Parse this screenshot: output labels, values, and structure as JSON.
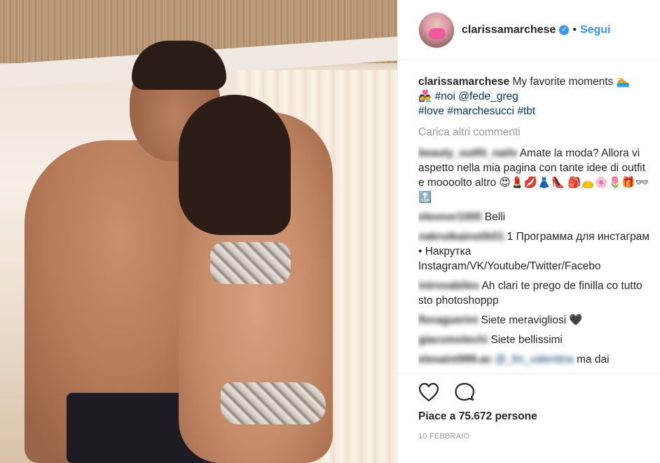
{
  "post": {
    "username": "clarissamarchese",
    "follow_label": "Segui",
    "separator": "•",
    "verified_glyph": "✓",
    "caption": {
      "username": "clarissamarchese",
      "text": "My favorite moments 🏊",
      "line2_emoji": "👩‍❤️‍👨",
      "hashtag_noi": "#noi",
      "mention": "@fede_greg",
      "hashtag_love": "#love",
      "hashtag_marchesucci": "#marchesucci",
      "hashtag_tbt": "#tbt"
    },
    "load_more": "Carica altri commenti",
    "comments": [
      {
        "user": "beauty_outfit_nails",
        "text": "Amate la moda? Allora vi aspetto nella mia pagina con tante idee di outfit e moooolto altro 😍💄💋👗👠 🎒👝🌸🌷🎁👓🔝"
      },
      {
        "user": "eleonor1000",
        "text": "Belli"
      },
      {
        "user": "nakrutkainstik01",
        "text": "1 Программа для инстаграм • Накрутка Instagram/VK/Youtube/Twitter/Facebo"
      },
      {
        "user": "introvabiles",
        "text": "Ah clari te prego de finilla co tutto sto photoshoppp"
      },
      {
        "user": "floraguerini",
        "text": "Siete meravigliosi 🖤"
      },
      {
        "user": "giacomolechi",
        "text": "Siete bellissimi"
      },
      {
        "user": "elesaint999.ac",
        "mention": "@_fm_valentina",
        "text": "ma dai"
      }
    ],
    "likes_text": "Piace a 75.672 persone",
    "date": "10 FEBBRAIO"
  },
  "icons": {
    "like": "heart-outline-icon",
    "comment": "speech-bubble-icon"
  },
  "colors": {
    "link_blue": "#3897f0",
    "text": "#262626",
    "muted": "#999999",
    "hashtag": "#003569"
  }
}
